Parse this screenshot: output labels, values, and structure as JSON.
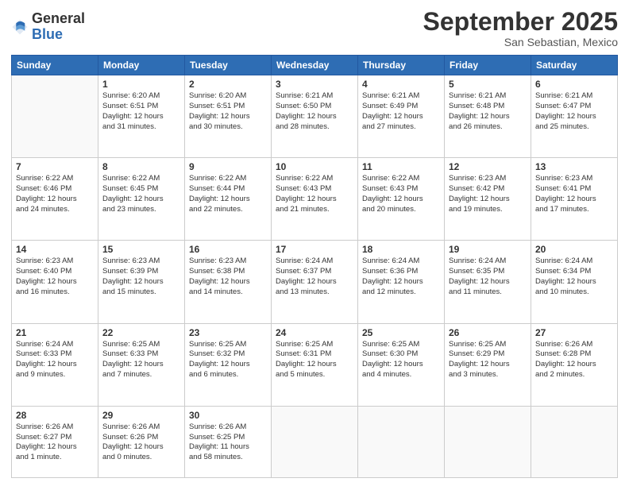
{
  "logo": {
    "general": "General",
    "blue": "Blue"
  },
  "header": {
    "month": "September 2025",
    "location": "San Sebastian, Mexico"
  },
  "weekdays": [
    "Sunday",
    "Monday",
    "Tuesday",
    "Wednesday",
    "Thursday",
    "Friday",
    "Saturday"
  ],
  "weeks": [
    [
      {
        "day": "",
        "info": ""
      },
      {
        "day": "1",
        "info": "Sunrise: 6:20 AM\nSunset: 6:51 PM\nDaylight: 12 hours\nand 31 minutes."
      },
      {
        "day": "2",
        "info": "Sunrise: 6:20 AM\nSunset: 6:51 PM\nDaylight: 12 hours\nand 30 minutes."
      },
      {
        "day": "3",
        "info": "Sunrise: 6:21 AM\nSunset: 6:50 PM\nDaylight: 12 hours\nand 28 minutes."
      },
      {
        "day": "4",
        "info": "Sunrise: 6:21 AM\nSunset: 6:49 PM\nDaylight: 12 hours\nand 27 minutes."
      },
      {
        "day": "5",
        "info": "Sunrise: 6:21 AM\nSunset: 6:48 PM\nDaylight: 12 hours\nand 26 minutes."
      },
      {
        "day": "6",
        "info": "Sunrise: 6:21 AM\nSunset: 6:47 PM\nDaylight: 12 hours\nand 25 minutes."
      }
    ],
    [
      {
        "day": "7",
        "info": "Sunrise: 6:22 AM\nSunset: 6:46 PM\nDaylight: 12 hours\nand 24 minutes."
      },
      {
        "day": "8",
        "info": "Sunrise: 6:22 AM\nSunset: 6:45 PM\nDaylight: 12 hours\nand 23 minutes."
      },
      {
        "day": "9",
        "info": "Sunrise: 6:22 AM\nSunset: 6:44 PM\nDaylight: 12 hours\nand 22 minutes."
      },
      {
        "day": "10",
        "info": "Sunrise: 6:22 AM\nSunset: 6:43 PM\nDaylight: 12 hours\nand 21 minutes."
      },
      {
        "day": "11",
        "info": "Sunrise: 6:22 AM\nSunset: 6:43 PM\nDaylight: 12 hours\nand 20 minutes."
      },
      {
        "day": "12",
        "info": "Sunrise: 6:23 AM\nSunset: 6:42 PM\nDaylight: 12 hours\nand 19 minutes."
      },
      {
        "day": "13",
        "info": "Sunrise: 6:23 AM\nSunset: 6:41 PM\nDaylight: 12 hours\nand 17 minutes."
      }
    ],
    [
      {
        "day": "14",
        "info": "Sunrise: 6:23 AM\nSunset: 6:40 PM\nDaylight: 12 hours\nand 16 minutes."
      },
      {
        "day": "15",
        "info": "Sunrise: 6:23 AM\nSunset: 6:39 PM\nDaylight: 12 hours\nand 15 minutes."
      },
      {
        "day": "16",
        "info": "Sunrise: 6:23 AM\nSunset: 6:38 PM\nDaylight: 12 hours\nand 14 minutes."
      },
      {
        "day": "17",
        "info": "Sunrise: 6:24 AM\nSunset: 6:37 PM\nDaylight: 12 hours\nand 13 minutes."
      },
      {
        "day": "18",
        "info": "Sunrise: 6:24 AM\nSunset: 6:36 PM\nDaylight: 12 hours\nand 12 minutes."
      },
      {
        "day": "19",
        "info": "Sunrise: 6:24 AM\nSunset: 6:35 PM\nDaylight: 12 hours\nand 11 minutes."
      },
      {
        "day": "20",
        "info": "Sunrise: 6:24 AM\nSunset: 6:34 PM\nDaylight: 12 hours\nand 10 minutes."
      }
    ],
    [
      {
        "day": "21",
        "info": "Sunrise: 6:24 AM\nSunset: 6:33 PM\nDaylight: 12 hours\nand 9 minutes."
      },
      {
        "day": "22",
        "info": "Sunrise: 6:25 AM\nSunset: 6:33 PM\nDaylight: 12 hours\nand 7 minutes."
      },
      {
        "day": "23",
        "info": "Sunrise: 6:25 AM\nSunset: 6:32 PM\nDaylight: 12 hours\nand 6 minutes."
      },
      {
        "day": "24",
        "info": "Sunrise: 6:25 AM\nSunset: 6:31 PM\nDaylight: 12 hours\nand 5 minutes."
      },
      {
        "day": "25",
        "info": "Sunrise: 6:25 AM\nSunset: 6:30 PM\nDaylight: 12 hours\nand 4 minutes."
      },
      {
        "day": "26",
        "info": "Sunrise: 6:25 AM\nSunset: 6:29 PM\nDaylight: 12 hours\nand 3 minutes."
      },
      {
        "day": "27",
        "info": "Sunrise: 6:26 AM\nSunset: 6:28 PM\nDaylight: 12 hours\nand 2 minutes."
      }
    ],
    [
      {
        "day": "28",
        "info": "Sunrise: 6:26 AM\nSunset: 6:27 PM\nDaylight: 12 hours\nand 1 minute."
      },
      {
        "day": "29",
        "info": "Sunrise: 6:26 AM\nSunset: 6:26 PM\nDaylight: 12 hours\nand 0 minutes."
      },
      {
        "day": "30",
        "info": "Sunrise: 6:26 AM\nSunset: 6:25 PM\nDaylight: 11 hours\nand 58 minutes."
      },
      {
        "day": "",
        "info": ""
      },
      {
        "day": "",
        "info": ""
      },
      {
        "day": "",
        "info": ""
      },
      {
        "day": "",
        "info": ""
      }
    ]
  ]
}
